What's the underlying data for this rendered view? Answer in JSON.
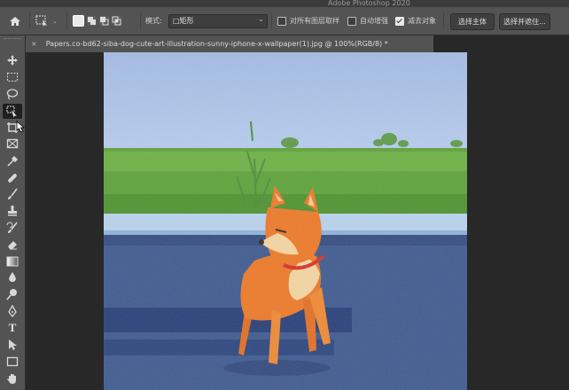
{
  "app": {
    "window_title": "Adobe Photoshop 2020"
  },
  "options_bar": {
    "mode_label": "模式:",
    "mode_value": "□矩形",
    "checkbox_all_layers": {
      "label": "对所有图层取样",
      "checked": false
    },
    "checkbox_auto_enhance": {
      "label": "自动增强",
      "checked": false
    },
    "checkbox_subtract_object": {
      "label": "减去对象",
      "checked": true
    },
    "select_subject_label": "选择主体",
    "select_and_mask_label": "选择并遮住..."
  },
  "document": {
    "tab_title": "Papers.co-bd62-siba-dog-cute-art-illustration-sunny-iphone-x-wallpaper(1).jpg @ 100%(RGB/8) *",
    "close_glyph": "×"
  },
  "tools": [
    {
      "name": "move-tool",
      "icon": "move-icon"
    },
    {
      "name": "marquee-tool",
      "icon": "rect-marquee-icon"
    },
    {
      "name": "lasso-tool",
      "icon": "lasso-icon"
    },
    {
      "name": "object-selection-tool",
      "icon": "object-selection-icon",
      "selected": true
    },
    {
      "name": "crop-tool",
      "icon": "crop-icon"
    },
    {
      "name": "frame-tool",
      "icon": "frame-icon"
    },
    {
      "name": "eyedropper-tool",
      "icon": "eyedropper-icon"
    },
    {
      "name": "healing-brush-tool",
      "icon": "bandage-icon"
    },
    {
      "name": "brush-tool",
      "icon": "brush-icon"
    },
    {
      "name": "clone-stamp-tool",
      "icon": "stamp-icon"
    },
    {
      "name": "history-brush-tool",
      "icon": "history-brush-icon"
    },
    {
      "name": "eraser-tool",
      "icon": "eraser-icon"
    },
    {
      "name": "gradient-tool",
      "icon": "gradient-icon"
    },
    {
      "name": "blur-tool",
      "icon": "drop-icon"
    },
    {
      "name": "dodge-tool",
      "icon": "dodge-icon"
    },
    {
      "name": "pen-tool",
      "icon": "pen-icon"
    },
    {
      "name": "type-tool",
      "icon": "type-icon",
      "glyph": "T"
    },
    {
      "name": "path-selection-tool",
      "icon": "arrow-icon"
    },
    {
      "name": "rectangle-tool",
      "icon": "rectangle-icon"
    },
    {
      "name": "hand-tool",
      "icon": "hand-icon"
    }
  ],
  "colors": {
    "ui_dark": "#282828",
    "ui_panel": "#535353",
    "sky": "#a9c1e6",
    "grass": "#5fa33c",
    "road": "#3e5a8f",
    "dog": "#ee7a28"
  }
}
